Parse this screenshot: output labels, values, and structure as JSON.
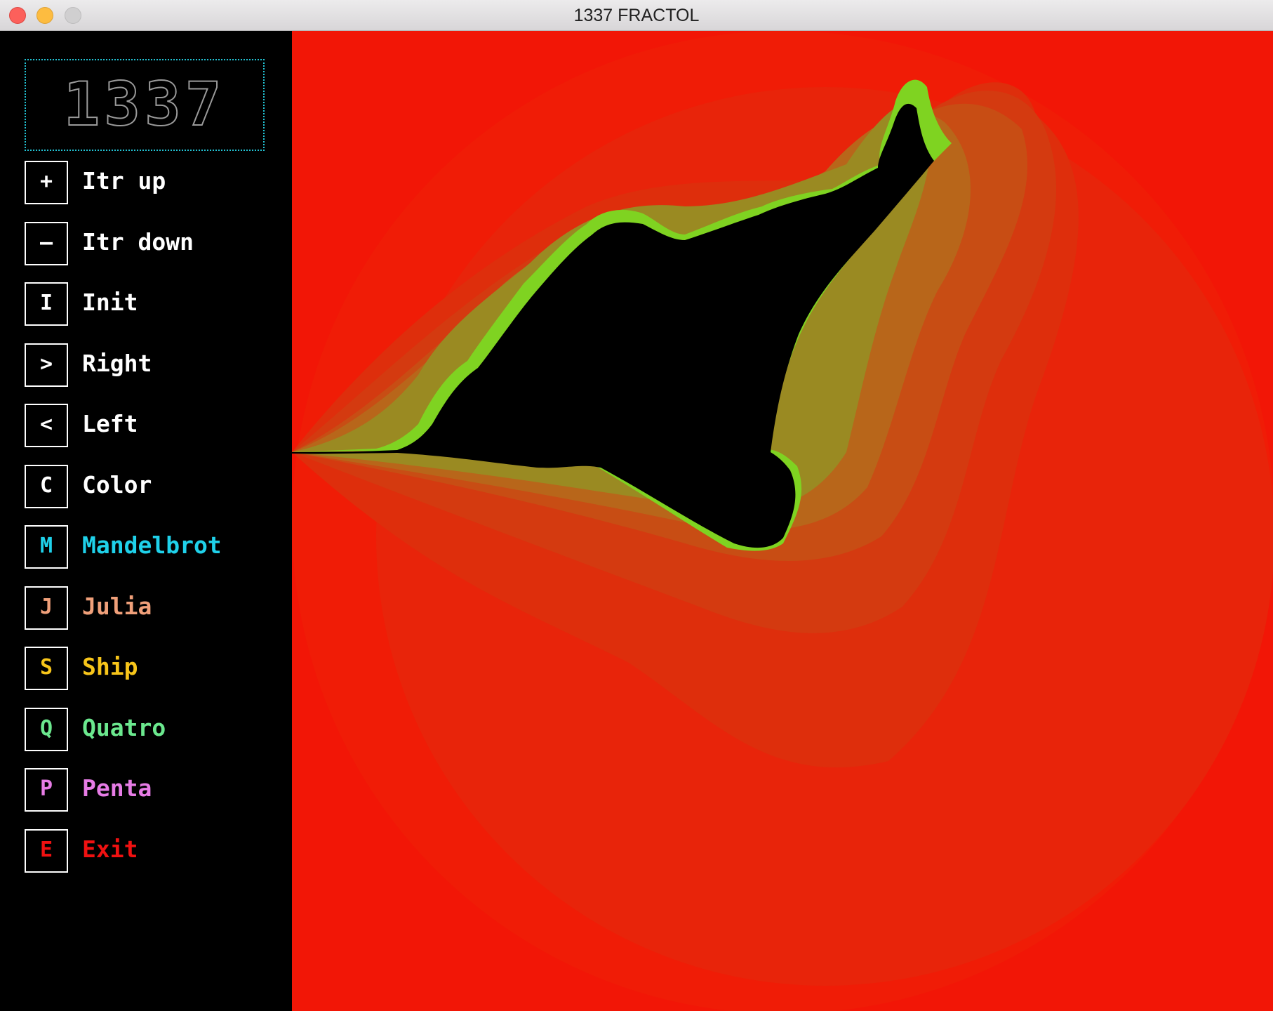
{
  "window": {
    "title": "1337 FRACTOL"
  },
  "logo": {
    "text": "1337"
  },
  "menu": [
    {
      "key": "+",
      "label": "Itr up",
      "color": "#ffffff",
      "key_color": "#ffffff",
      "icon": "plus-icon"
    },
    {
      "key": "–",
      "label": "Itr down",
      "color": "#ffffff",
      "key_color": "#ffffff",
      "icon": "minus-icon"
    },
    {
      "key": "I",
      "label": "Init",
      "color": "#ffffff",
      "key_color": "#ffffff"
    },
    {
      "key": ">",
      "label": "Right",
      "color": "#ffffff",
      "key_color": "#ffffff",
      "icon": "chevron-right-icon"
    },
    {
      "key": "<",
      "label": "Left",
      "color": "#ffffff",
      "key_color": "#ffffff",
      "icon": "chevron-left-icon"
    },
    {
      "key": "C",
      "label": "Color",
      "color": "#ffffff",
      "key_color": "#ffffff"
    },
    {
      "key": "M",
      "label": "Mandelbrot",
      "color": "#1fd1ea",
      "key_color": "#1fd1ea"
    },
    {
      "key": "J",
      "label": "Julia",
      "color": "#f0a07a",
      "key_color": "#f0a07a"
    },
    {
      "key": "S",
      "label": "Ship",
      "color": "#f7c51a",
      "key_color": "#f7c51a"
    },
    {
      "key": "Q",
      "label": "Quatro",
      "color": "#6be88e",
      "key_color": "#6be88e"
    },
    {
      "key": "P",
      "label": "Penta",
      "color": "#e77ce6",
      "key_color": "#e77ce6"
    },
    {
      "key": "E",
      "label": "Exit",
      "color": "#f01111",
      "key_color": "#f01111"
    }
  ],
  "colors": {
    "canvas_background": "#f21606",
    "fractal_set": "#000000",
    "fractal_edge": "#7ed321",
    "logo_border": "#22c3d4"
  }
}
